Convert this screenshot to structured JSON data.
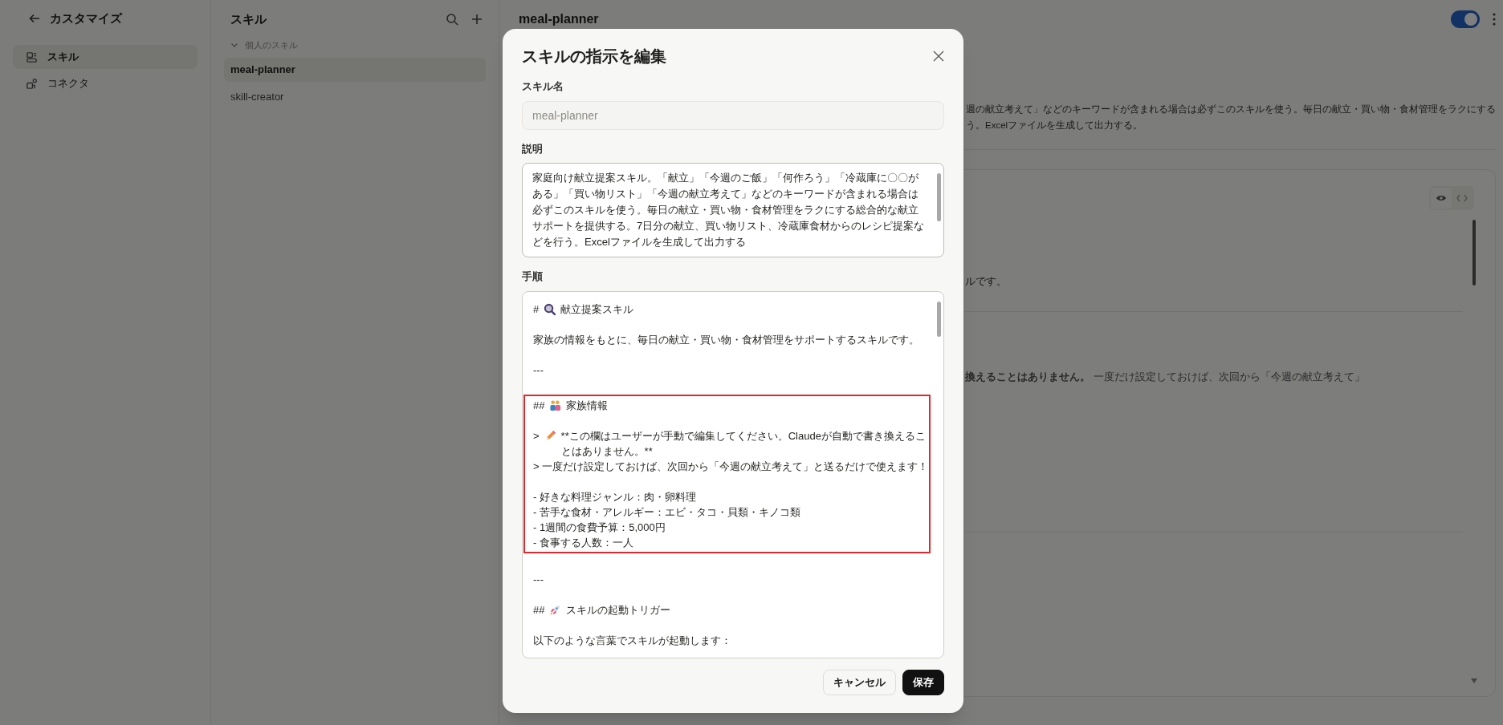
{
  "sidebar": {
    "back_label": "カスタマイズ",
    "items": [
      {
        "label": "スキル",
        "selected": true
      },
      {
        "label": "コネクタ",
        "selected": false
      }
    ]
  },
  "skills_panel": {
    "title": "スキル",
    "group": {
      "label": "個人のスキル",
      "expanded": true,
      "items": [
        {
          "label": "meal-planner",
          "selected": true
        },
        {
          "label": "skill-creator",
          "selected": false
        }
      ]
    }
  },
  "detail": {
    "title": "meal-planner",
    "enabled": true,
    "description_lines": [
      "週の献立考えて」などのキーワードが含まれる場合は必ずこのスキルを使う。毎日の献立・買い物・食材管理をラクにする",
      "う。Excelファイルを生成して出力する。"
    ],
    "card_lines": [
      "ルです。",
      "**換えることはありません。** 一度だけ設定しておけば、次回から「今週の献立考えて」"
    ]
  },
  "dialog": {
    "title": "スキルの指示を編集",
    "name_field": {
      "label": "スキル名",
      "value": "meal-planner",
      "disabled": true
    },
    "description_field": {
      "label": "説明",
      "value": "家庭向け献立提案スキル。「献立」「今週のご飯」「何作ろう」「冷蔵庫に〇〇がある」「買い物リスト」「今週の献立考えて」などのキーワードが含まれる場合は必ずこのスキルを使う。毎日の献立・買い物・食材管理をラクにする総合的な献立サポートを提供する。7日分の献立、買い物リスト、冷蔵庫食材からのレシピ提案などを行う。Excelファイルを生成して出力する"
    },
    "instructions_field": {
      "label": "手順",
      "blocks": [
        {
          "highlighted": false,
          "paragraphs": [
            [
              {
                "prefix": "#",
                "text": "献立提案スキル"
              }
            ],
            [
              {
                "text": "家族の情報をもとに、毎日の献立・買い物・食材管理をサポートするスキルです。"
              }
            ],
            [
              {
                "text": "---"
              }
            ]
          ]
        },
        {
          "highlighted": true,
          "paragraphs": [
            [
              {
                "prefix": "##",
                "text": "家族情報"
              }
            ],
            [
              {
                "prefix": ">",
                "text": "**この欄はユーザーが手動で編集してください。Claudeが自動で書き換えることはありません。**"
              },
              {
                "text": "> 一度だけ設定しておけば、次回から「今週の献立考えて」と送るだけで使えます！"
              }
            ],
            [
              {
                "text": "- 好きな料理ジャンル：肉・卵料理"
              },
              {
                "text": "- 苦手な食材・アレルギー：エビ・タコ・貝類・キノコ類"
              },
              {
                "text": "- 1週間の食費予算：5,000円"
              },
              {
                "text": "- 食事する人数：一人"
              }
            ]
          ]
        },
        {
          "highlighted": false,
          "paragraphs": [
            [
              {
                "text": "---"
              }
            ],
            [
              {
                "prefix": "##",
                "text": "スキルの起動トリガー"
              }
            ],
            [
              {
                "text": "以下のような言葉でスキルが起動します："
              }
            ]
          ]
        }
      ]
    },
    "buttons": [
      {
        "label": "キャンセル",
        "kind": "secondary"
      },
      {
        "label": "保存",
        "kind": "primary"
      }
    ]
  }
}
